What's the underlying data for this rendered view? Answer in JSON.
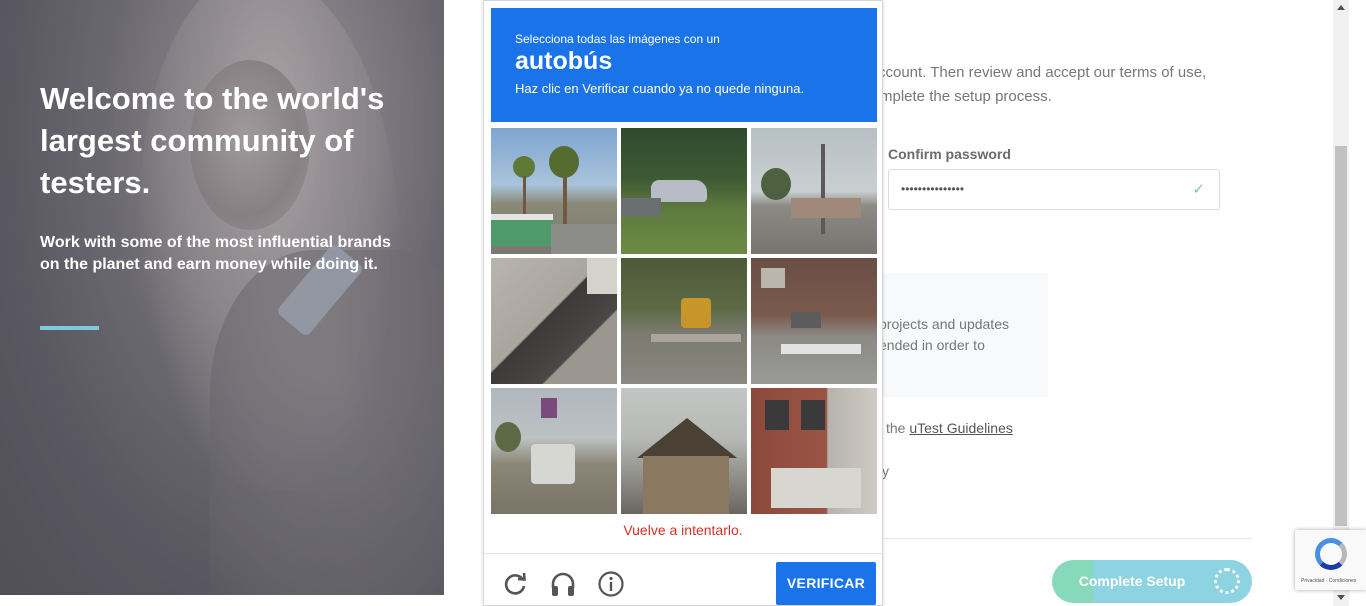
{
  "hero": {
    "title": "Welcome to the world's largest community of testers.",
    "subtitle": "Work with some of the most influential brands on the planet and earn money while doing it."
  },
  "form": {
    "intro_line1": "ccount. Then review and accept our terms of use,",
    "intro_line2": "mplete the setup process.",
    "confirm_password_label": "Confirm password",
    "confirm_password_value": "•••••••••••••••",
    "info_line1": "projects and updates",
    "info_line2": "ended in order to",
    "guidelines_prefix": "the ",
    "guidelines_link": "uTest Guidelines",
    "truncated_text": "y",
    "complete_button": "Complete Setup"
  },
  "captcha": {
    "select_text": "Selecciona todas las imágenes con un",
    "target_object": "autobús",
    "instruction": "Haz clic en Verificar cuando ya no quede ninguna.",
    "tiles": [
      "palm-trees-tram",
      "grass-road-car",
      "street-intersection",
      "truck-side",
      "school-bus-road",
      "brick-building-street",
      "bus-stop-street",
      "house-gable",
      "brick-rowhouse"
    ],
    "error": "Vuelve a intentarlo.",
    "verify_button": "VERIFICAR"
  },
  "badge": {
    "terms": "Privacidad - Condiciones"
  },
  "colors": {
    "captcha_blue": "#1a73e8",
    "error_red": "#d93025",
    "hero_accent": "#7fc9de",
    "button_green": "#86d9bb",
    "button_teal": "#8ed3e2"
  }
}
